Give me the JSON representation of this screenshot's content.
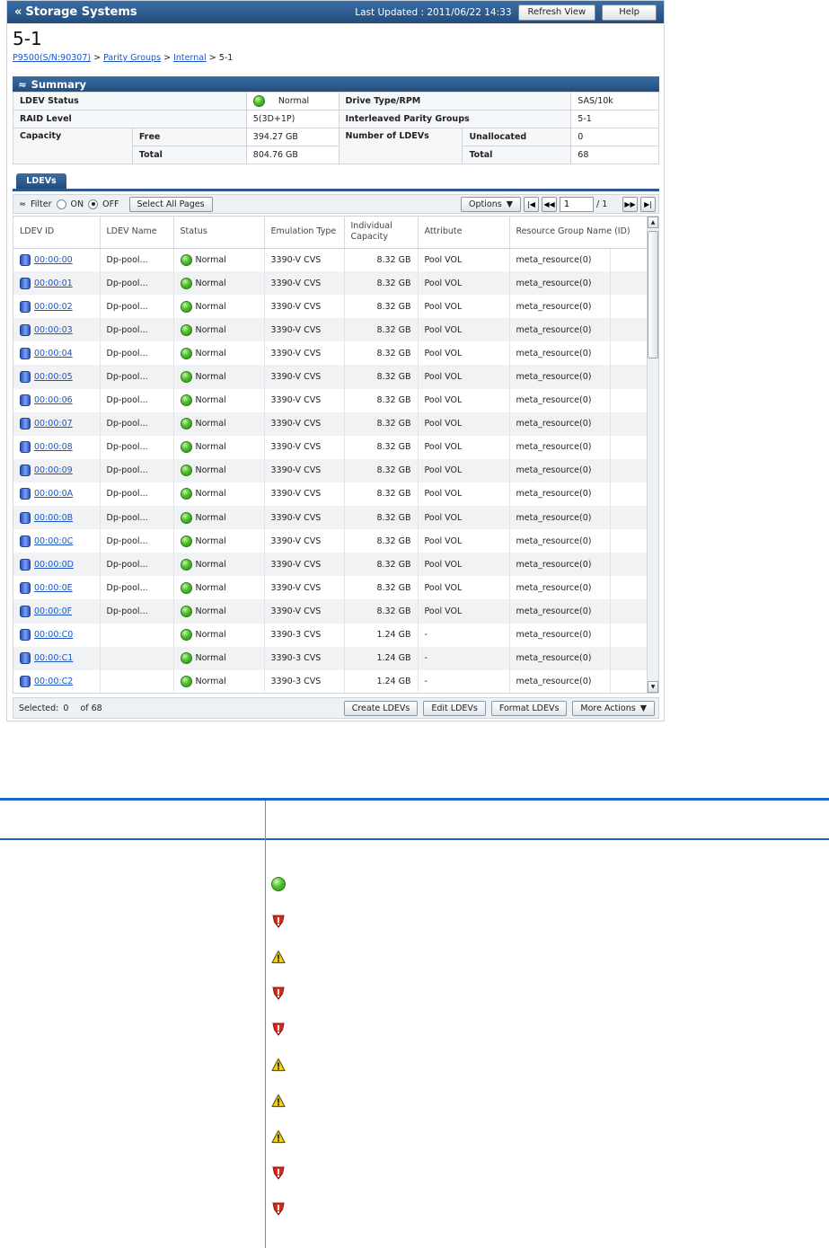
{
  "app": {
    "title": "Storage Systems",
    "last_updated": "Last Updated : 2011/06/22 14:33",
    "refresh_label": "Refresh View",
    "help_label": "Help"
  },
  "page": {
    "title": "5-1",
    "breadcrumb": {
      "storage": "P9500(S/N:90307)",
      "sep": ">",
      "parity": "Parity Groups",
      "internal": "Internal",
      "current": "5-1"
    }
  },
  "summary": {
    "header": "Summary",
    "ldev_status_label": "LDEV Status",
    "ldev_status_value": "Normal",
    "drive_type_label": "Drive Type/RPM",
    "drive_type_value": "SAS/10k",
    "raid_level_label": "RAID Level",
    "raid_level_value": "5(3D+1P)",
    "interleaved_label": "Interleaved Parity Groups",
    "interleaved_value": "5-1",
    "capacity_label": "Capacity",
    "free_label": "Free",
    "free_value": "394.27 GB",
    "total_label": "Total",
    "total_value": "804.76 GB",
    "num_ldevs_label": "Number of LDEVs",
    "unallocated_label": "Unallocated",
    "unallocated_value": "0",
    "ldev_total_label": "Total",
    "ldev_total_value": "68"
  },
  "ldevs": {
    "tab_label": "LDEVs",
    "filter_label": "Filter",
    "filter_on": "ON",
    "filter_off": "OFF",
    "select_all_pages": "Select All Pages",
    "options_label": "Options",
    "page_current": "1",
    "page_total": "/ 1",
    "columns": {
      "id": "LDEV ID",
      "name": "LDEV Name",
      "status": "Status",
      "emulation": "Emulation Type",
      "capacity": "Individual Capacity",
      "attribute": "Attribute",
      "resource": "Resource Group Name (ID)"
    },
    "rows": [
      {
        "id": "00:00:00",
        "name": "Dp-pool...",
        "status": "Normal",
        "emulation": "3390-V CVS",
        "capacity": "8.32 GB",
        "attribute": "Pool VOL",
        "resource": "meta_resource(0)"
      },
      {
        "id": "00:00:01",
        "name": "Dp-pool...",
        "status": "Normal",
        "emulation": "3390-V CVS",
        "capacity": "8.32 GB",
        "attribute": "Pool VOL",
        "resource": "meta_resource(0)"
      },
      {
        "id": "00:00:02",
        "name": "Dp-pool...",
        "status": "Normal",
        "emulation": "3390-V CVS",
        "capacity": "8.32 GB",
        "attribute": "Pool VOL",
        "resource": "meta_resource(0)"
      },
      {
        "id": "00:00:03",
        "name": "Dp-pool...",
        "status": "Normal",
        "emulation": "3390-V CVS",
        "capacity": "8.32 GB",
        "attribute": "Pool VOL",
        "resource": "meta_resource(0)"
      },
      {
        "id": "00:00:04",
        "name": "Dp-pool...",
        "status": "Normal",
        "emulation": "3390-V CVS",
        "capacity": "8.32 GB",
        "attribute": "Pool VOL",
        "resource": "meta_resource(0)"
      },
      {
        "id": "00:00:05",
        "name": "Dp-pool...",
        "status": "Normal",
        "emulation": "3390-V CVS",
        "capacity": "8.32 GB",
        "attribute": "Pool VOL",
        "resource": "meta_resource(0)"
      },
      {
        "id": "00:00:06",
        "name": "Dp-pool...",
        "status": "Normal",
        "emulation": "3390-V CVS",
        "capacity": "8.32 GB",
        "attribute": "Pool VOL",
        "resource": "meta_resource(0)"
      },
      {
        "id": "00:00:07",
        "name": "Dp-pool...",
        "status": "Normal",
        "emulation": "3390-V CVS",
        "capacity": "8.32 GB",
        "attribute": "Pool VOL",
        "resource": "meta_resource(0)"
      },
      {
        "id": "00:00:08",
        "name": "Dp-pool...",
        "status": "Normal",
        "emulation": "3390-V CVS",
        "capacity": "8.32 GB",
        "attribute": "Pool VOL",
        "resource": "meta_resource(0)"
      },
      {
        "id": "00:00:09",
        "name": "Dp-pool...",
        "status": "Normal",
        "emulation": "3390-V CVS",
        "capacity": "8.32 GB",
        "attribute": "Pool VOL",
        "resource": "meta_resource(0)"
      },
      {
        "id": "00:00:0A",
        "name": "Dp-pool...",
        "status": "Normal",
        "emulation": "3390-V CVS",
        "capacity": "8.32 GB",
        "attribute": "Pool VOL",
        "resource": "meta_resource(0)"
      },
      {
        "id": "00:00:0B",
        "name": "Dp-pool...",
        "status": "Normal",
        "emulation": "3390-V CVS",
        "capacity": "8.32 GB",
        "attribute": "Pool VOL",
        "resource": "meta_resource(0)"
      },
      {
        "id": "00:00:0C",
        "name": "Dp-pool...",
        "status": "Normal",
        "emulation": "3390-V CVS",
        "capacity": "8.32 GB",
        "attribute": "Pool VOL",
        "resource": "meta_resource(0)"
      },
      {
        "id": "00:00:0D",
        "name": "Dp-pool...",
        "status": "Normal",
        "emulation": "3390-V CVS",
        "capacity": "8.32 GB",
        "attribute": "Pool VOL",
        "resource": "meta_resource(0)"
      },
      {
        "id": "00:00:0E",
        "name": "Dp-pool...",
        "status": "Normal",
        "emulation": "3390-V CVS",
        "capacity": "8.32 GB",
        "attribute": "Pool VOL",
        "resource": "meta_resource(0)"
      },
      {
        "id": "00:00:0F",
        "name": "Dp-pool...",
        "status": "Normal",
        "emulation": "3390-V CVS",
        "capacity": "8.32 GB",
        "attribute": "Pool VOL",
        "resource": "meta_resource(0)"
      },
      {
        "id": "00:00:C0",
        "name": "",
        "status": "Normal",
        "emulation": "3390-3 CVS",
        "capacity": "1.24 GB",
        "attribute": "-",
        "resource": "meta_resource(0)"
      },
      {
        "id": "00:00:C1",
        "name": "",
        "status": "Normal",
        "emulation": "3390-3 CVS",
        "capacity": "1.24 GB",
        "attribute": "-",
        "resource": "meta_resource(0)"
      },
      {
        "id": "00:00:C2",
        "name": "",
        "status": "Normal",
        "emulation": "3390-3 CVS",
        "capacity": "1.24 GB",
        "attribute": "-",
        "resource": "meta_resource(0)"
      }
    ],
    "selected_label": "Selected:",
    "selected_value": "0",
    "of_label": "of 68",
    "create_label": "Create LDEVs",
    "edit_label": "Edit LDEVs",
    "format_label": "Format LDEVs",
    "more_label": "More Actions"
  },
  "status_icons": [
    "ok-icon",
    "error-icon",
    "warning-icon",
    "error-icon",
    "error-icon",
    "warning-icon",
    "warning-icon",
    "warning-icon",
    "error-icon",
    "error-icon"
  ],
  "colors": {
    "header_blue": "#234d7c",
    "link_blue": "#1a55c8",
    "status_green": "#4fbf2c",
    "error_red": "#d9281c",
    "warning_yellow": "#f2d11c"
  }
}
